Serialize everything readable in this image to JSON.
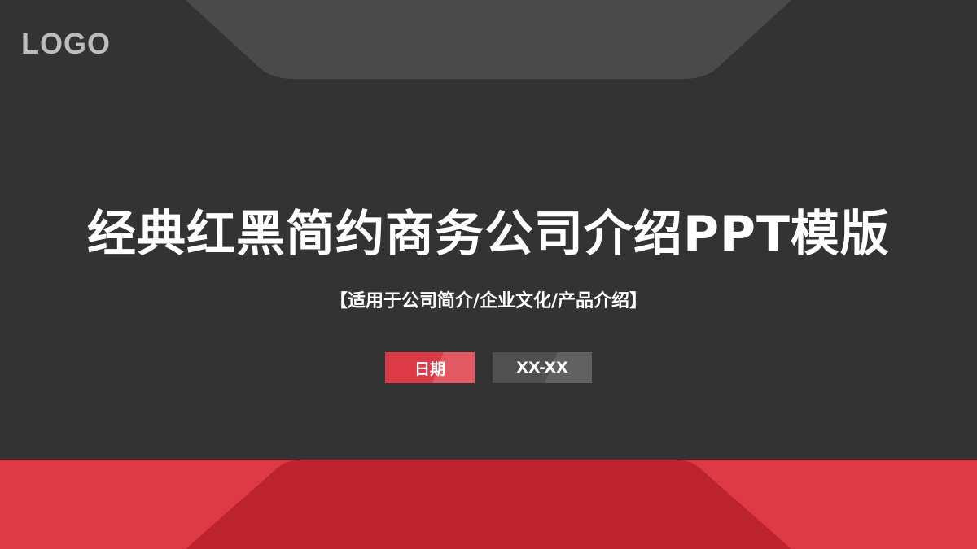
{
  "logo": {
    "text": "LOGO"
  },
  "title": "经典红黑简约商务公司介绍PPT模版",
  "subtitle": "【适用于公司简介/企业文化/产品介绍】",
  "date_tag": {
    "label": "日期"
  },
  "date_value": {
    "text": "XX-XX"
  },
  "colors": {
    "background": "#333333",
    "top_panel": "#4a4a4a",
    "logo_text": "#bdbdbd",
    "text": "#ffffff",
    "red_light": "#dd3a45",
    "red_dark": "#bd232e",
    "tag_red": "#dc3a46",
    "tag_gray": "#505050"
  }
}
